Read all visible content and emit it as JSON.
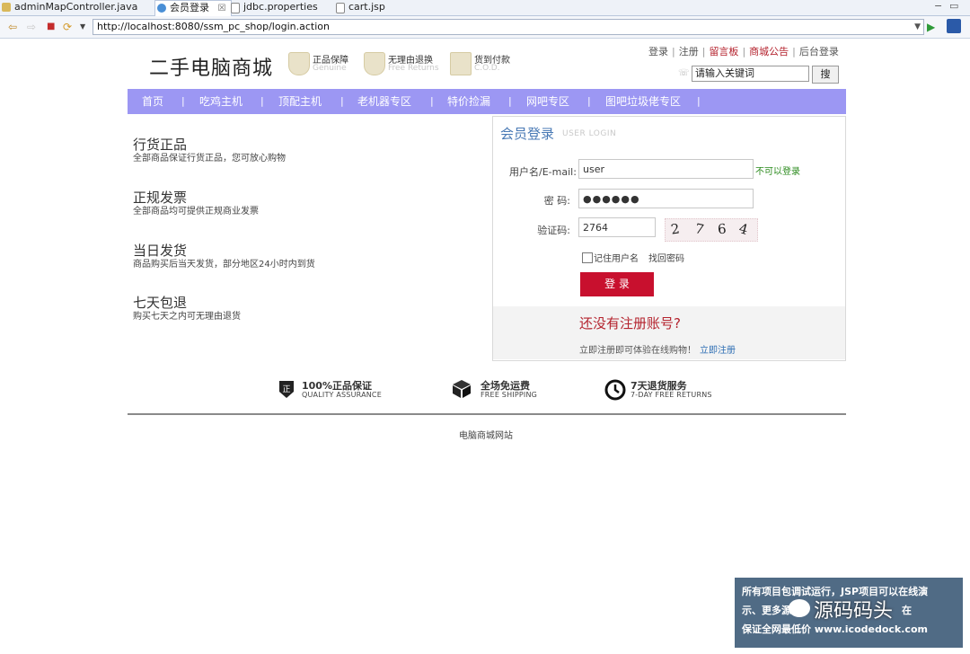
{
  "editor_tabs": [
    {
      "label": "adminMapController.java",
      "icon": "java-file-icon"
    },
    {
      "label": "会员登录",
      "icon": "browser-globe-icon",
      "active": true
    },
    {
      "label": "jdbc.properties",
      "icon": "properties-file-icon"
    },
    {
      "label": "cart.jsp",
      "icon": "jsp-file-icon"
    }
  ],
  "browser": {
    "url": "http://localhost:8080/ssm_pc_shop/login.action"
  },
  "site": {
    "logo": "二手电脑商城",
    "badges": [
      {
        "title": "正品保障",
        "subtitle": "Genuine"
      },
      {
        "title": "无理由退换",
        "subtitle": "Free Returns"
      },
      {
        "title": "货到付款",
        "subtitle": "C.O.D."
      }
    ],
    "top_links": [
      "登录",
      "注册",
      "留言板",
      "商城公告",
      "后台登录"
    ],
    "search": {
      "value": "请输入关键词",
      "button": "搜"
    },
    "nav": [
      "首页",
      "吃鸡主机",
      "顶配主机",
      "老机器专区",
      "特价捡漏",
      "网吧专区",
      "图吧垃圾佬专区"
    ]
  },
  "features": [
    {
      "title": "行货正品",
      "desc": "全部商品保证行货正品，您可放心购物"
    },
    {
      "title": "正规发票",
      "desc": "全部商品均可提供正规商业发票"
    },
    {
      "title": "当日发货",
      "desc": "商品购买后当天发货，部分地区24小时内到货"
    },
    {
      "title": "七天包退",
      "desc": "购买七天之内可无理由退货"
    }
  ],
  "login": {
    "title": "会员登录",
    "title_en": "USER LOGIN",
    "username_label": "用户名/E-mail:",
    "username_value": "user",
    "username_status": "不可以登录",
    "password_label": "密  码:",
    "password_value": "●●●●●●",
    "captcha_label": "验证码:",
    "captcha_value": "2764",
    "captcha_chars": [
      "2",
      "7",
      "6",
      "4"
    ],
    "remember_label": "记住用户名",
    "forgot_label": "找回密码",
    "submit_label": "登 录",
    "no_account": "还没有注册账号?",
    "register_text": "立即注册即可体验在线购物！",
    "register_link": "立即注册"
  },
  "services": [
    {
      "title": "100%正品保证",
      "subtitle": "QUALITY ASSURANCE",
      "icon": "genuine-shield-icon"
    },
    {
      "title": "全场免运费",
      "subtitle": "FREE SHIPPING",
      "icon": "package-box-icon"
    },
    {
      "title": "7天退货服务",
      "subtitle": "7-DAY FREE RETURNS",
      "icon": "clock-icon"
    }
  ],
  "footer": "电脑商城网站",
  "watermark": {
    "line1": "所有项目包调试运行，JSP项目可以在线演",
    "line2": "示、更多源",
    "line2b": "在",
    "line3": "保证全网最低价 www.icodedock.com",
    "brand": "源码码头"
  },
  "colors": {
    "nav_bg": "#9c97f3",
    "login_button": "#c8102e",
    "accent_red": "#b4232e",
    "title_blue": "#4a7ab5",
    "ok_green": "#2a8a1c"
  }
}
